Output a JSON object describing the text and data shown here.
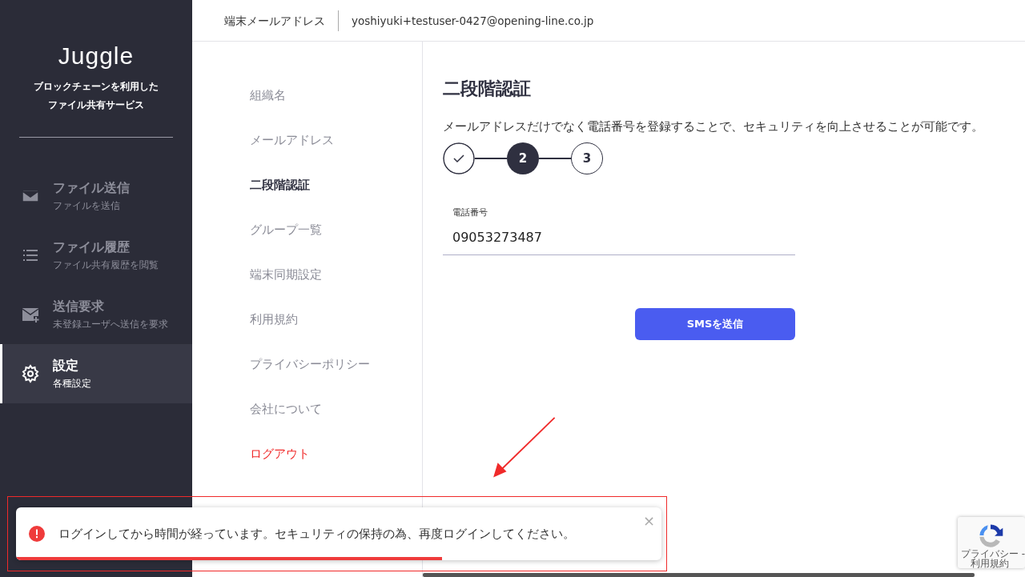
{
  "sidebar": {
    "logo": "Juggle",
    "tagline": [
      "ブロックチェーンを利用した",
      "ファイル共有サービス"
    ],
    "items": [
      {
        "kind": "mail",
        "title": "ファイル送信",
        "subtitle": "ファイルを送信",
        "selected": false
      },
      {
        "kind": "list",
        "title": "ファイル履歴",
        "subtitle": "ファイル共有履歴を閲覧",
        "selected": false
      },
      {
        "kind": "mail-plus",
        "title": "送信要求",
        "subtitle": "未登録ユーザへ送信を要求",
        "selected": false
      },
      {
        "kind": "gear",
        "title": "設定",
        "subtitle": "各種設定",
        "selected": true
      }
    ]
  },
  "top_bar": {
    "label": "端末メールアドレス",
    "email": "yoshiyuki+testuser-0427@opening-line.co.jp"
  },
  "settings_menu": [
    {
      "label": "組織名",
      "selected": false,
      "kind": "normal"
    },
    {
      "label": "メールアドレス",
      "selected": false,
      "kind": "normal"
    },
    {
      "label": "二段階認証",
      "selected": true,
      "kind": "normal"
    },
    {
      "label": "グループ一覧",
      "selected": false,
      "kind": "normal"
    },
    {
      "label": "端末同期設定",
      "selected": false,
      "kind": "normal"
    },
    {
      "label": "利用規約",
      "selected": false,
      "kind": "normal"
    },
    {
      "label": "プライバシーポリシー",
      "selected": false,
      "kind": "normal"
    },
    {
      "label": "会社について",
      "selected": false,
      "kind": "normal"
    },
    {
      "label": "ログアウト",
      "selected": false,
      "kind": "danger"
    }
  ],
  "content": {
    "title": "二段階認証",
    "description": "メールアドレスだけでなく電話番号を登録することで、セキュリティを向上させることが可能です。",
    "steps": [
      {
        "kind": "done"
      },
      {
        "kind": "current",
        "label": "2"
      },
      {
        "kind": "upcoming",
        "label": "3"
      }
    ],
    "phone_field": {
      "label": "電話番号",
      "value": "09053273487"
    },
    "button": "SMSを送信"
  },
  "toast": {
    "message": "ログインしてから時間が経っています。セキュリティの保持の為、再度ログインしてください。",
    "close": "×",
    "level": 0.66
  },
  "recaptcha": {
    "links": [
      "プライバシー -",
      "利用規約"
    ]
  }
}
